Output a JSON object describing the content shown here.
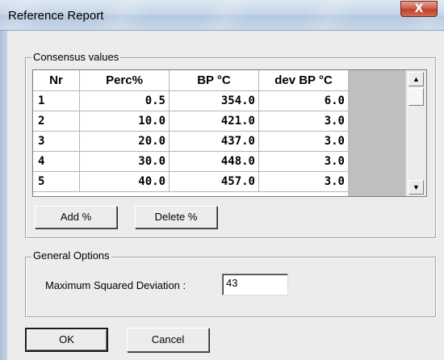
{
  "window": {
    "title": "Reference Report",
    "close_label": "X"
  },
  "consensus": {
    "group_label": "Consensus values",
    "columns": [
      "Nr",
      "Perc%",
      "BP °C",
      "dev BP °C"
    ],
    "rows": [
      [
        "1",
        "0.5",
        "354.0",
        "6.0"
      ],
      [
        "2",
        "10.0",
        "421.0",
        "3.0"
      ],
      [
        "3",
        "20.0",
        "437.0",
        "3.0"
      ],
      [
        "4",
        "30.0",
        "448.0",
        "3.0"
      ],
      [
        "5",
        "40.0",
        "457.0",
        "3.0"
      ]
    ],
    "add_label": "Add %",
    "delete_label": "Delete %"
  },
  "general_options": {
    "group_label": "General Options",
    "max_sq_dev_label": "Maximum Squared Deviation :",
    "max_sq_dev_value": "43"
  },
  "buttons": {
    "ok_label": "OK",
    "cancel_label": "Cancel"
  },
  "icons": {
    "close": "close-icon",
    "scroll_up": "scroll-up-arrow-icon",
    "scroll_down": "scroll-down-arrow-icon"
  }
}
